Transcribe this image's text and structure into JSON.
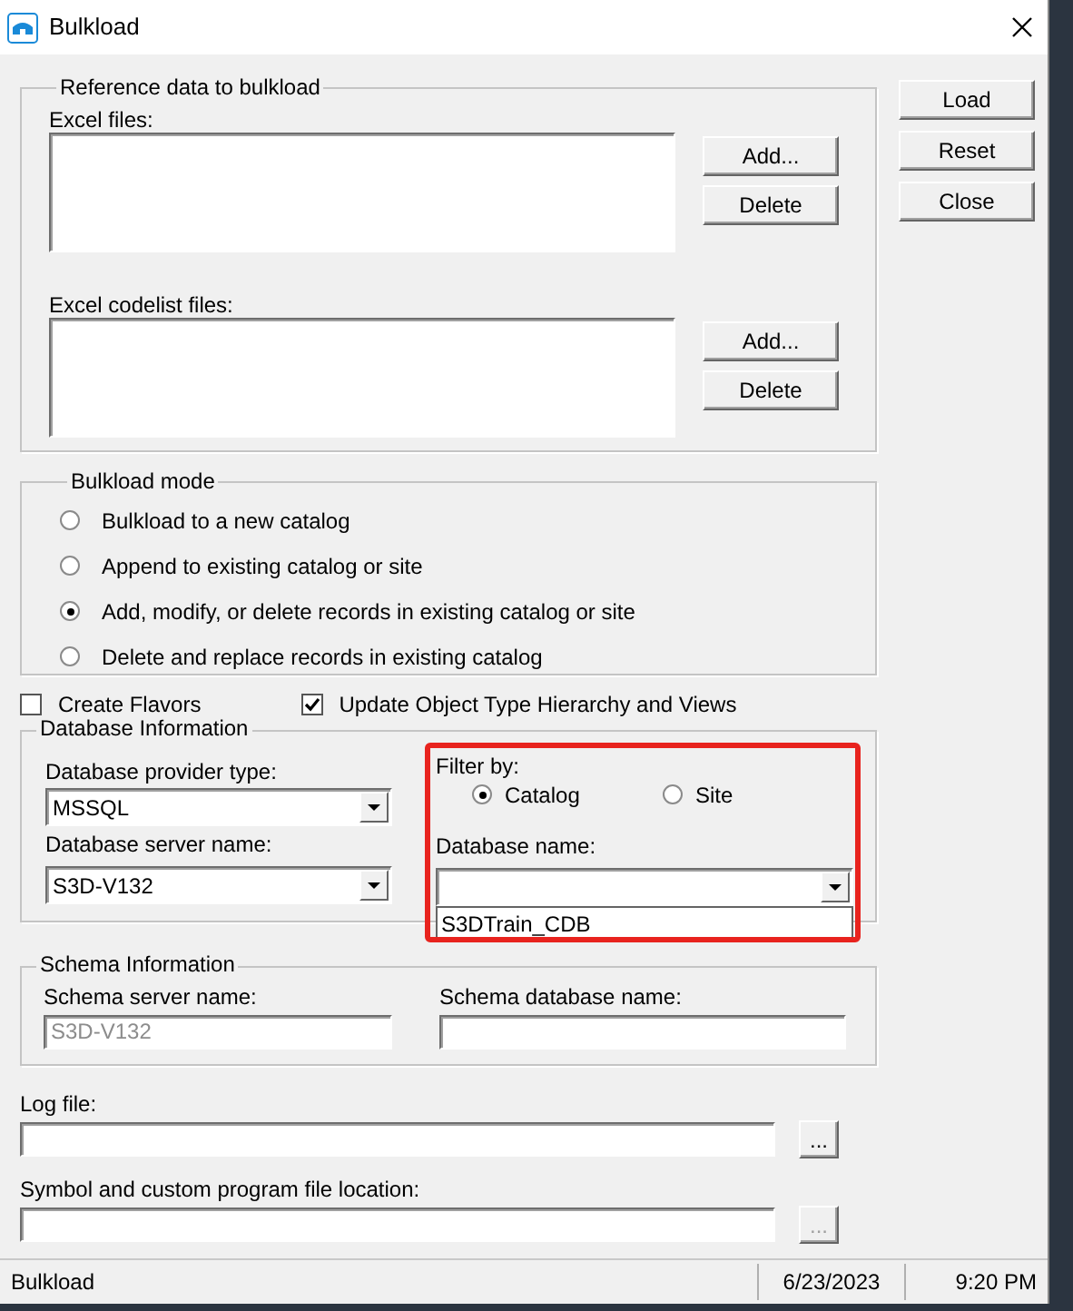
{
  "window": {
    "title": "Bulkload"
  },
  "side_buttons": [
    {
      "label": "Load"
    },
    {
      "label": "Reset"
    },
    {
      "label": "Close"
    }
  ],
  "reference_data": {
    "title": "Reference data to bulkload",
    "lists": [
      {
        "label": "Excel files:",
        "buttons": [
          "Add...",
          "Delete"
        ]
      },
      {
        "label": "Excel codelist files:",
        "buttons": [
          "Add...",
          "Delete"
        ]
      }
    ]
  },
  "bulkload_mode": {
    "title": "Bulkload mode",
    "options": [
      {
        "label": "Bulkload to a new catalog",
        "selected": false
      },
      {
        "label": "Append to existing  catalog or site",
        "selected": false
      },
      {
        "label": "Add, modify, or delete records in existing catalog or site",
        "selected": true
      },
      {
        "label": "Delete and replace records in existing catalog",
        "selected": false
      }
    ]
  },
  "checkboxes": [
    {
      "label": "Create Flavors",
      "checked": false
    },
    {
      "label": "Update Object Type Hierarchy and Views",
      "checked": true
    }
  ],
  "database_information": {
    "title": "Database Information",
    "provider": {
      "label": "Database provider type:",
      "value": "MSSQL"
    },
    "server": {
      "label": "Database server name:",
      "value": "S3D-V132"
    },
    "filter_panel": {
      "highlighted": true,
      "label": "Filter by:",
      "options": [
        {
          "label": "Catalog",
          "selected": true
        },
        {
          "label": "Site",
          "selected": false
        }
      ],
      "database_name": {
        "label": "Database name:",
        "dropdown_items": [
          "S3DTrain_CDB"
        ]
      }
    }
  },
  "schema_information": {
    "title": "Schema Information",
    "server": {
      "label": "Schema server name:",
      "value": "S3D-V132",
      "disabled": true
    },
    "database": {
      "label": "Schema database name:"
    }
  },
  "log_file": {
    "label": "Log file:",
    "browse": {
      "label": "...",
      "disabled": false
    }
  },
  "symbol_location": {
    "label": "Symbol and custom program file location:",
    "browse": {
      "label": "...",
      "disabled": true
    }
  },
  "status_bar": {
    "text": "Bulkload",
    "date": "6/23/2023",
    "time": "9:20 PM"
  }
}
